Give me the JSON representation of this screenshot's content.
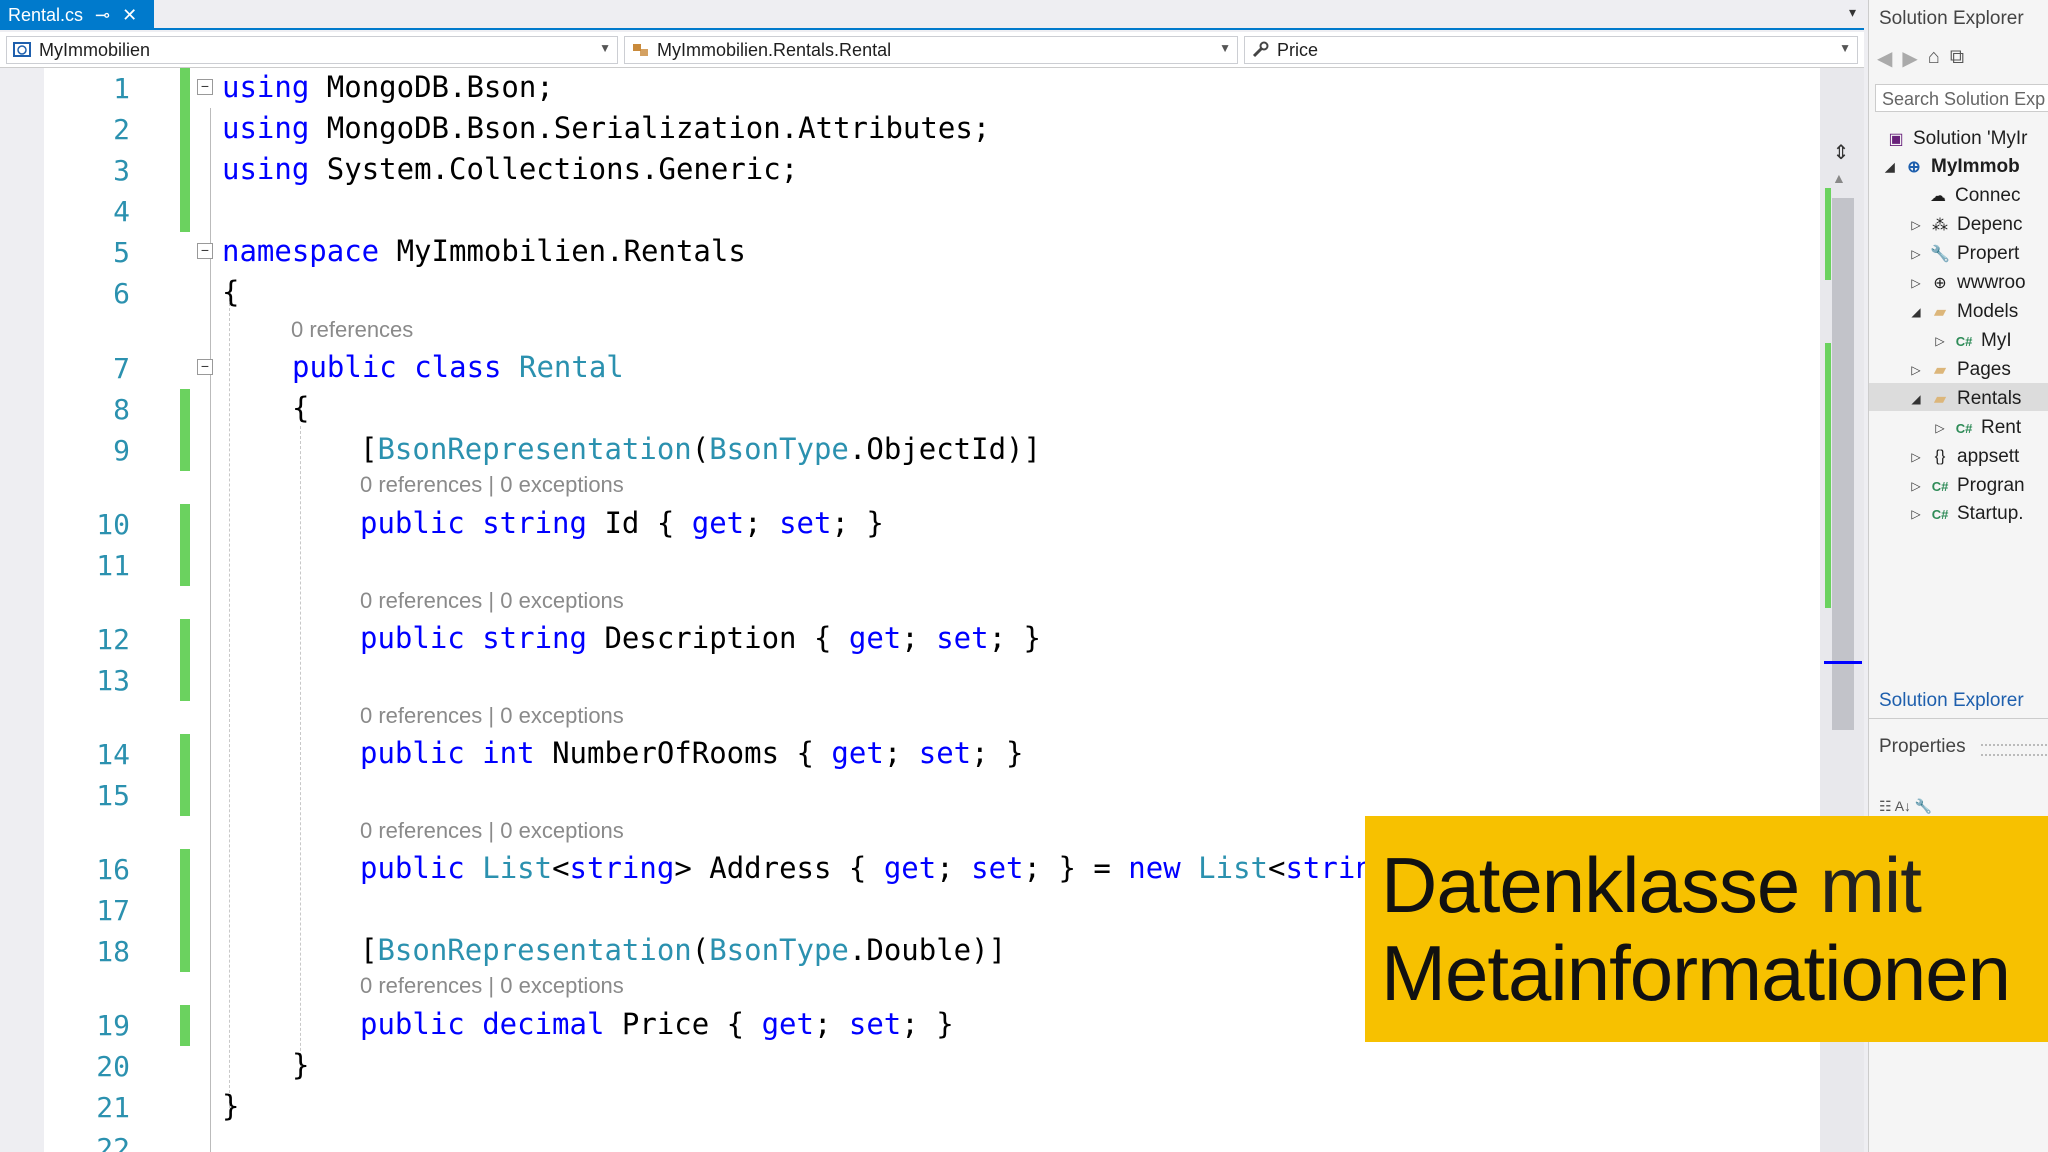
{
  "tab": {
    "title": "Rental.cs",
    "pin": "⊸",
    "close": "✕"
  },
  "navbar": {
    "project": "MyImmobilien",
    "type": "MyImmobilien.Rentals.Rental",
    "member": "Price"
  },
  "code_lines": [
    {
      "n": "1"
    },
    {
      "n": "2"
    },
    {
      "n": "3"
    },
    {
      "n": "4"
    },
    {
      "n": "5"
    },
    {
      "n": "6"
    },
    {
      "n": "7"
    },
    {
      "n": "8"
    },
    {
      "n": "9"
    },
    {
      "n": "10"
    },
    {
      "n": "11"
    },
    {
      "n": "12"
    },
    {
      "n": "13"
    },
    {
      "n": "14"
    },
    {
      "n": "15"
    },
    {
      "n": "16"
    },
    {
      "n": "17"
    },
    {
      "n": "18"
    },
    {
      "n": "19"
    },
    {
      "n": "20"
    },
    {
      "n": "21"
    },
    {
      "n": "22"
    }
  ],
  "code": {
    "l1_kw": "using",
    "l1_rest": " MongoDB.Bson;",
    "l2_kw": "using",
    "l2_rest": " MongoDB.Bson.Serialization.Attributes;",
    "l3_kw": "using",
    "l3_rest": " System.Collections.Generic;",
    "l5_kw": "namespace",
    "l5_rest": " MyImmobilien.Rentals",
    "l6": "{",
    "l7_kw": "public class",
    "l7_ty": "Rental",
    "l8": "{",
    "l9_a": "[",
    "l9_ty1": "BsonRepresentation",
    "l9_b": "(",
    "l9_ty2": "BsonType",
    "l9_c": ".ObjectId)]",
    "l10_kw": "public string",
    "l10_a": " Id { ",
    "l10_get": "get",
    "l10_b": "; ",
    "l10_set": "set",
    "l10_c": "; }",
    "l12_kw": "public string",
    "l12_a": " Description { ",
    "l12_get": "get",
    "l12_b": "; ",
    "l12_set": "set",
    "l12_c": "; }",
    "l14_kw": "public int",
    "l14_a": " NumberOfRooms { ",
    "l14_get": "get",
    "l14_b": "; ",
    "l14_set": "set",
    "l14_c": "; }",
    "l16_kw": "public",
    "l16_ty": "List",
    "l16_a": "<",
    "l16_kw2": "string",
    "l16_b": "> Address { ",
    "l16_get": "get",
    "l16_c": "; ",
    "l16_set": "set",
    "l16_d": "; } = ",
    "l16_new": "new",
    "l16_ty2": "List",
    "l16_e": "<",
    "l16_kw3": "strin",
    "l18_a": "[",
    "l18_ty1": "BsonRepresentation",
    "l18_b": "(",
    "l18_ty2": "BsonType",
    "l18_c": ".Double)]",
    "l19_kw": "public decimal",
    "l19_a": " Price { ",
    "l19_get": "get",
    "l19_b": "; ",
    "l19_set": "set",
    "l19_c": "; }",
    "l20": "}",
    "l21": "}"
  },
  "codelens": {
    "class_refs": "0 references",
    "refs": "0 references",
    "sep": "|",
    "exceptions": "0 exceptions"
  },
  "solution_explorer": {
    "title": "Solution Explorer",
    "search_placeholder": "Search Solution Exp",
    "items": [
      {
        "label": "Solution 'MyIr"
      },
      {
        "label": "MyImmob"
      },
      {
        "label": "Connec"
      },
      {
        "label": "Depenc"
      },
      {
        "label": "Propert"
      },
      {
        "label": "wwwroo"
      },
      {
        "label": "Models"
      },
      {
        "label": "MyI"
      },
      {
        "label": "Pages"
      },
      {
        "label": "Rentals"
      },
      {
        "label": "Rent"
      },
      {
        "label": "appsett"
      },
      {
        "label": "Progran"
      },
      {
        "label": "Startup."
      }
    ],
    "bottom_tab": "Solution Explorer",
    "properties_title": "Properties"
  },
  "overlay": {
    "line1_a": "Datenklasse",
    "line1_b": " mit",
    "line2": "Metainformationen"
  },
  "colors": {
    "accent": "#007acc",
    "keyword": "#0000ff",
    "type": "#2b91af",
    "change_marker": "#6bd25f",
    "overlay_bg": "#f7c100"
  }
}
